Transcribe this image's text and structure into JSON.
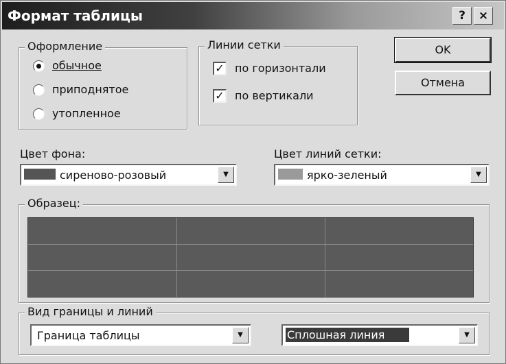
{
  "window": {
    "title": "Формат таблицы",
    "help_button": "?",
    "close_button": "×"
  },
  "design_group": {
    "legend": "Оформление",
    "options": [
      {
        "label": "обычное",
        "selected": true
      },
      {
        "label": "приподнятое",
        "selected": false
      },
      {
        "label": "утопленное",
        "selected": false
      }
    ]
  },
  "grid_group": {
    "legend": "Линии сетки",
    "options": [
      {
        "label": "по горизонтали",
        "checked": true
      },
      {
        "label": "по вертикали",
        "checked": true
      }
    ],
    "check_glyph": "✓"
  },
  "buttons": {
    "ok": "OK",
    "cancel": "Отмена"
  },
  "background_color": {
    "label": "Цвет фона:",
    "value": "сиреново-розовый",
    "swatch": "#555555"
  },
  "grid_color": {
    "label": "Цвет линий сетки:",
    "value": "ярко-зеленый",
    "swatch": "#9a9a9a"
  },
  "sample": {
    "legend": "Образец:",
    "fill": "#5a5a5a",
    "line": "#8a8a8a"
  },
  "border_group": {
    "legend": "Вид границы и линий",
    "target_value": "Граница таблицы",
    "style_value": "Сплошная линия"
  },
  "dropdown_arrow": "▼"
}
